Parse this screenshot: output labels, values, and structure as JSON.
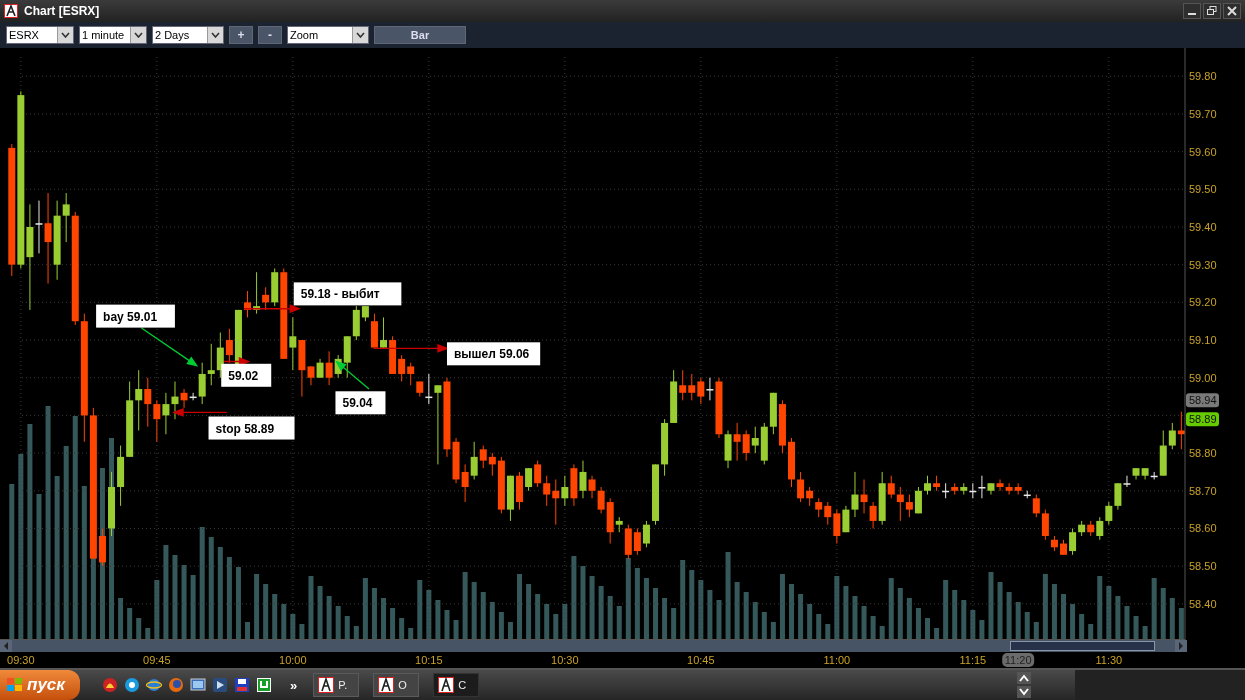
{
  "window": {
    "title": "Chart [ESRX]"
  },
  "toolbar": {
    "symbol": "ESRX",
    "interval": "1 minute",
    "range": "2 Days",
    "zoom_in": "+",
    "zoom_out": "-",
    "mode": "Zoom",
    "style_button": "Bar"
  },
  "chart": {
    "chart_data": {
      "type": "candlestick",
      "ylim": [
        58.304,
        59.875
      ],
      "xlim": [
        567.7,
        698.4
      ],
      "grid": true,
      "yticks": [
        {
          "value": 59.8,
          "label": "59.80"
        },
        {
          "value": 59.7,
          "label": "59.70"
        },
        {
          "value": 59.6,
          "label": "59.60"
        },
        {
          "value": 59.5,
          "label": "59.50"
        },
        {
          "value": 59.4,
          "label": "59.40"
        },
        {
          "value": 59.3,
          "label": "59.30"
        },
        {
          "value": 59.2,
          "label": "59.20"
        },
        {
          "value": 59.1,
          "label": "59.10"
        },
        {
          "value": 59.0,
          "label": "59.00"
        },
        {
          "value": 58.8,
          "label": "58.80"
        },
        {
          "value": 58.7,
          "label": "58.70"
        },
        {
          "value": 58.6,
          "label": "58.60"
        },
        {
          "value": 58.5,
          "label": "58.50"
        },
        {
          "value": 58.4,
          "label": "58.40"
        }
      ],
      "xticks": [
        {
          "value": 570,
          "label": "09:30"
        },
        {
          "value": 585,
          "label": "09:45"
        },
        {
          "value": 600,
          "label": "10:00"
        },
        {
          "value": 615,
          "label": "10:15"
        },
        {
          "value": 630,
          "label": "10:30"
        },
        {
          "value": 645,
          "label": "10:45"
        },
        {
          "value": 660,
          "label": "11:00"
        },
        {
          "value": 675,
          "label": "11:15"
        },
        {
          "value": 690,
          "label": "11:30"
        }
      ],
      "x": [
        569,
        570,
        571,
        572,
        573,
        574,
        575,
        576,
        577,
        578,
        579,
        580,
        581,
        582,
        583,
        584,
        585,
        586,
        587,
        588,
        589,
        590,
        591,
        592,
        593,
        594,
        595,
        596,
        597,
        598,
        599,
        600,
        601,
        602,
        603,
        604,
        605,
        606,
        607,
        608,
        609,
        610,
        611,
        612,
        613,
        614,
        615,
        616,
        617,
        618,
        619,
        620,
        621,
        622,
        623,
        624,
        625,
        626,
        627,
        628,
        629,
        630,
        631,
        632,
        633,
        634,
        635,
        636,
        637,
        638,
        639,
        640,
        641,
        642,
        643,
        644,
        645,
        646,
        647,
        648,
        649,
        650,
        651,
        652,
        653,
        654,
        655,
        656,
        657,
        658,
        659,
        660,
        661,
        662,
        663,
        664,
        665,
        666,
        667,
        668,
        669,
        670,
        671,
        672,
        673,
        674,
        675,
        676,
        677,
        678,
        679,
        680,
        681,
        682,
        683,
        684,
        685,
        686,
        687,
        688,
        689,
        690,
        691,
        692,
        693,
        694,
        695,
        696,
        697,
        698
      ],
      "ohlc": [
        [
          59.61,
          59.62,
          59.27,
          59.3
        ],
        [
          59.3,
          59.76,
          59.29,
          59.75
        ],
        [
          59.32,
          59.46,
          59.18,
          59.4
        ],
        [
          59.41,
          59.47,
          59.33,
          59.41
        ],
        [
          59.41,
          59.49,
          59.25,
          59.36
        ],
        [
          59.3,
          59.47,
          59.26,
          59.43
        ],
        [
          59.43,
          59.49,
          59.36,
          59.46
        ],
        [
          59.43,
          59.44,
          59.14,
          59.15
        ],
        [
          59.15,
          59.17,
          58.83,
          58.9
        ],
        [
          58.9,
          58.92,
          58.52,
          58.52
        ],
        [
          58.58,
          58.6,
          58.5,
          58.51
        ],
        [
          58.6,
          58.75,
          58.58,
          58.71
        ],
        [
          58.71,
          58.82,
          58.66,
          58.79
        ],
        [
          58.79,
          58.99,
          58.79,
          58.94
        ],
        [
          58.94,
          59.02,
          58.86,
          58.97
        ],
        [
          58.97,
          59.0,
          58.87,
          58.93
        ],
        [
          58.93,
          58.94,
          58.83,
          58.89
        ],
        [
          58.9,
          58.96,
          58.85,
          58.93
        ],
        [
          58.93,
          58.99,
          58.89,
          58.95
        ],
        [
          58.96,
          58.97,
          58.92,
          58.94
        ],
        [
          58.95,
          58.96,
          58.94,
          58.95
        ],
        [
          58.95,
          59.04,
          58.93,
          59.01
        ],
        [
          59.01,
          59.09,
          58.98,
          59.02
        ],
        [
          59.02,
          59.12,
          59.0,
          59.08
        ],
        [
          59.1,
          59.13,
          59.04,
          59.06
        ],
        [
          59.02,
          59.18,
          59.02,
          59.18
        ],
        [
          59.2,
          59.23,
          59.16,
          59.18
        ],
        [
          59.18,
          59.28,
          59.17,
          59.19
        ],
        [
          59.22,
          59.24,
          59.18,
          59.2
        ],
        [
          59.2,
          59.29,
          59.19,
          59.28
        ],
        [
          59.28,
          59.29,
          59.05,
          59.05
        ],
        [
          59.08,
          59.16,
          59.02,
          59.11
        ],
        [
          59.1,
          59.1,
          58.95,
          59.02
        ],
        [
          59.03,
          59.03,
          58.98,
          59.0
        ],
        [
          59.0,
          59.05,
          59.0,
          59.04
        ],
        [
          59.04,
          59.07,
          58.98,
          59.0
        ],
        [
          59.01,
          59.06,
          59.0,
          59.05
        ],
        [
          59.04,
          59.11,
          59.0,
          59.11
        ],
        [
          59.11,
          59.19,
          59.1,
          59.18
        ],
        [
          59.16,
          59.19,
          59.15,
          59.19
        ],
        [
          59.15,
          59.17,
          59.08,
          59.08
        ],
        [
          59.08,
          59.16,
          59.08,
          59.1
        ],
        [
          59.1,
          59.11,
          59.01,
          59.01
        ],
        [
          59.05,
          59.06,
          58.99,
          59.01
        ],
        [
          59.03,
          59.04,
          58.98,
          59.01
        ],
        [
          58.99,
          58.99,
          58.95,
          58.96
        ],
        [
          58.95,
          59.01,
          58.93,
          58.95
        ],
        [
          58.96,
          58.98,
          58.77,
          58.98
        ],
        [
          58.99,
          59.0,
          58.79,
          58.81
        ],
        [
          58.83,
          58.84,
          58.72,
          58.73
        ],
        [
          58.75,
          58.77,
          58.67,
          58.71
        ],
        [
          58.74,
          58.83,
          58.73,
          58.79
        ],
        [
          58.81,
          58.82,
          58.76,
          58.78
        ],
        [
          58.79,
          58.8,
          58.74,
          58.77
        ],
        [
          58.78,
          58.79,
          58.64,
          58.65
        ],
        [
          58.65,
          58.74,
          58.62,
          58.74
        ],
        [
          58.74,
          58.75,
          58.65,
          58.67
        ],
        [
          58.71,
          58.76,
          58.7,
          58.76
        ],
        [
          58.77,
          58.78,
          58.71,
          58.72
        ],
        [
          58.72,
          58.74,
          58.66,
          58.69
        ],
        [
          58.7,
          58.73,
          58.61,
          58.68
        ],
        [
          58.68,
          58.74,
          58.66,
          58.71
        ],
        [
          58.76,
          58.77,
          58.66,
          58.68
        ],
        [
          58.7,
          58.78,
          58.68,
          58.75
        ],
        [
          58.73,
          58.74,
          58.68,
          58.7
        ],
        [
          58.7,
          58.71,
          58.64,
          58.65
        ],
        [
          58.67,
          58.68,
          58.56,
          58.59
        ],
        [
          58.61,
          58.63,
          58.59,
          58.62
        ],
        [
          58.6,
          58.61,
          58.52,
          58.53
        ],
        [
          58.59,
          58.6,
          58.53,
          58.54
        ],
        [
          58.56,
          58.62,
          58.55,
          58.61
        ],
        [
          58.62,
          58.77,
          58.61,
          58.77
        ],
        [
          58.77,
          58.89,
          58.74,
          58.88
        ],
        [
          58.88,
          59.02,
          58.88,
          58.99
        ],
        [
          58.98,
          59.02,
          58.94,
          58.96
        ],
        [
          58.98,
          59.01,
          58.94,
          58.96
        ],
        [
          58.99,
          59.0,
          58.93,
          58.95
        ],
        [
          58.97,
          59.0,
          58.94,
          58.97
        ],
        [
          58.99,
          59.0,
          58.84,
          58.85
        ],
        [
          58.78,
          58.86,
          58.76,
          58.85
        ],
        [
          58.85,
          58.88,
          58.78,
          58.83
        ],
        [
          58.85,
          58.86,
          58.78,
          58.8
        ],
        [
          58.82,
          58.87,
          58.8,
          58.84
        ],
        [
          58.78,
          58.88,
          58.77,
          58.87
        ],
        [
          58.87,
          58.96,
          58.85,
          58.96
        ],
        [
          58.93,
          58.94,
          58.8,
          58.82
        ],
        [
          58.83,
          58.84,
          58.71,
          58.73
        ],
        [
          58.73,
          58.75,
          58.67,
          58.68
        ],
        [
          58.7,
          58.71,
          58.66,
          58.68
        ],
        [
          58.67,
          58.68,
          58.63,
          58.65
        ],
        [
          58.66,
          58.67,
          58.61,
          58.63
        ],
        [
          58.64,
          58.65,
          58.56,
          58.58
        ],
        [
          58.59,
          58.66,
          58.59,
          58.65
        ],
        [
          58.65,
          58.75,
          58.63,
          58.69
        ],
        [
          58.69,
          58.73,
          58.64,
          58.67
        ],
        [
          58.66,
          58.67,
          58.6,
          58.62
        ],
        [
          58.62,
          58.75,
          58.61,
          58.72
        ],
        [
          58.72,
          58.74,
          58.68,
          58.69
        ],
        [
          58.69,
          58.71,
          58.62,
          58.67
        ],
        [
          58.67,
          58.69,
          58.63,
          58.65
        ],
        [
          58.64,
          58.71,
          58.64,
          58.7
        ],
        [
          58.7,
          58.74,
          58.69,
          58.72
        ],
        [
          58.72,
          58.74,
          58.7,
          58.71
        ],
        [
          58.7,
          58.72,
          58.68,
          58.7
        ],
        [
          58.71,
          58.72,
          58.69,
          58.7
        ],
        [
          58.7,
          58.72,
          58.69,
          58.71
        ],
        [
          58.7,
          58.72,
          58.68,
          58.7
        ],
        [
          58.71,
          58.74,
          58.68,
          58.71
        ],
        [
          58.7,
          58.72,
          58.69,
          58.72
        ],
        [
          58.72,
          58.73,
          58.7,
          58.71
        ],
        [
          58.71,
          58.72,
          58.69,
          58.7
        ],
        [
          58.71,
          58.72,
          58.69,
          58.7
        ],
        [
          58.69,
          58.7,
          58.68,
          58.69
        ],
        [
          58.68,
          58.69,
          58.63,
          58.64
        ],
        [
          58.64,
          58.65,
          58.57,
          58.58
        ],
        [
          58.57,
          58.58,
          58.54,
          58.55
        ],
        [
          58.56,
          58.57,
          58.53,
          58.53
        ],
        [
          58.54,
          58.6,
          58.53,
          58.59
        ],
        [
          58.59,
          58.62,
          58.58,
          58.61
        ],
        [
          58.61,
          58.62,
          58.58,
          58.59
        ],
        [
          58.58,
          58.63,
          58.57,
          58.62
        ],
        [
          58.62,
          58.67,
          58.61,
          58.66
        ],
        [
          58.66,
          58.72,
          58.65,
          58.72
        ],
        [
          58.72,
          58.74,
          58.71,
          58.72
        ],
        [
          58.74,
          58.76,
          58.73,
          58.76
        ],
        [
          58.74,
          58.76,
          58.73,
          58.76
        ],
        [
          58.74,
          58.75,
          58.73,
          58.74
        ],
        [
          58.74,
          58.86,
          58.74,
          58.82
        ],
        [
          58.82,
          58.88,
          58.81,
          58.86
        ],
        [
          58.86,
          58.91,
          58.81,
          58.85
        ]
      ]
    },
    "annotations": [
      {
        "text": "bay 59.01",
        "color": "#00cc33"
      },
      {
        "text": "59.02",
        "color": "#cc0000"
      },
      {
        "text": "stop 58.89",
        "color": "#cc0000"
      },
      {
        "text": "59.18 - выбит",
        "color": "#cc0000"
      },
      {
        "text": "59.04",
        "color": "#00cc33"
      },
      {
        "text": "вышел 59.06",
        "color": "#cc0000"
      }
    ],
    "price_markers": [
      {
        "label": "58.94",
        "color": "#7a7a7a"
      },
      {
        "label": "58.89",
        "color": "#66cc00"
      }
    ],
    "cursor_time": "11:20"
  },
  "taskbar": {
    "start": "пуск",
    "more": "»",
    "tasks": [
      {
        "label": "P.",
        "selected": false
      },
      {
        "label": "O",
        "selected": false
      },
      {
        "label": "C",
        "selected": true
      }
    ]
  }
}
